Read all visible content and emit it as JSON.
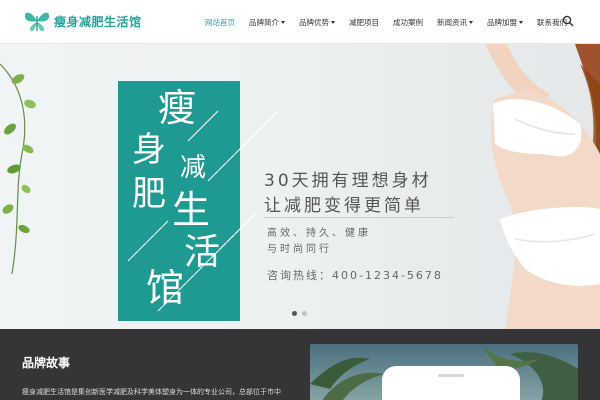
{
  "header": {
    "logo_text": "瘦身减肥生活馆",
    "nav": [
      {
        "label": "网站首页",
        "active": true,
        "dropdown": false
      },
      {
        "label": "品牌简介",
        "active": false,
        "dropdown": true
      },
      {
        "label": "品牌优势",
        "active": false,
        "dropdown": true
      },
      {
        "label": "减肥项目",
        "active": false,
        "dropdown": false
      },
      {
        "label": "成功案例",
        "active": false,
        "dropdown": false
      },
      {
        "label": "新闻资讯",
        "active": false,
        "dropdown": true
      },
      {
        "label": "品牌加盟",
        "active": false,
        "dropdown": true
      },
      {
        "label": "联系我们",
        "active": false,
        "dropdown": false
      }
    ],
    "search_icon": "search-icon"
  },
  "banner": {
    "vertical_title_chars": [
      "瘦",
      "身",
      "减",
      "肥",
      "生",
      "活",
      "馆"
    ],
    "slogan_line1": "30天拥有理想身材",
    "slogan_line2": "让减肥变得更简单",
    "features_line1": "高效、持久、健康",
    "features_line2": "与时尚同行",
    "hotline": "咨询热线：400-1234-5678",
    "active_slide": 1,
    "slide_count": 2
  },
  "story": {
    "title": "品牌故事",
    "text": "瘦身减肥生活馆是集创新医学减肥及科学美体塑身为一体的专业公司，总部位于市中"
  },
  "colors": {
    "accent": "#1f9a92",
    "logo": "#28a59a",
    "dark_bg": "#353538"
  }
}
